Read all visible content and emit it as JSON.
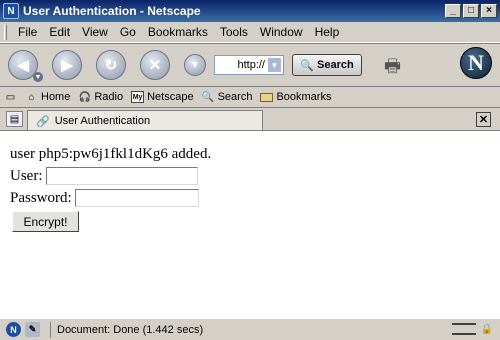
{
  "window": {
    "title": "User Authentication - Netscape"
  },
  "menu": [
    "File",
    "Edit",
    "View",
    "Go",
    "Bookmarks",
    "Tools",
    "Window",
    "Help"
  ],
  "toolbar": {
    "url_value": "http://",
    "search_label": "Search"
  },
  "personal_toolbar": {
    "items": [
      {
        "label": "Home",
        "icon": "home-icon"
      },
      {
        "label": "Radio",
        "icon": "radio-icon"
      },
      {
        "label": "Netscape",
        "icon": "my-netscape-icon"
      },
      {
        "label": "Search",
        "icon": "search-icon"
      },
      {
        "label": "Bookmarks",
        "icon": "folder-icon"
      }
    ],
    "my_badge": "My"
  },
  "tabs": [
    {
      "label": "User Authentication"
    }
  ],
  "content": {
    "message": "user php5:pw6j1fkl1dKg6 added.",
    "user_label": "User:",
    "password_label": "Password:",
    "submit_label": "Encrypt!"
  },
  "status": {
    "text": "Document: Done (1.442 secs)"
  }
}
